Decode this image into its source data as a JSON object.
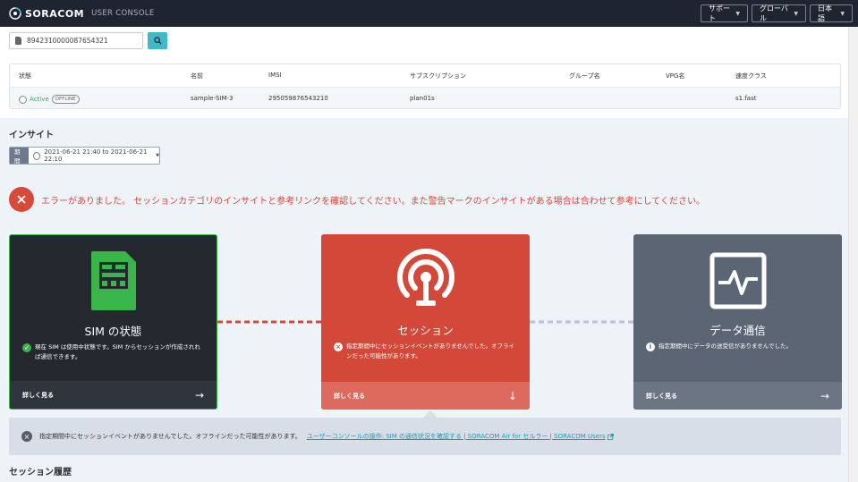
{
  "header": {
    "brand": "SORACOM",
    "subtitle": "USER CONSOLE",
    "buttons": [
      {
        "label": "サポート"
      },
      {
        "label": "グローバル"
      },
      {
        "label": "日本語"
      }
    ]
  },
  "search": {
    "value": "8942310000087654321",
    "icon": "search-icon"
  },
  "sim_table": {
    "columns": [
      "状態",
      "名前",
      "IMSI",
      "サブスクリプション",
      "グループ名",
      "VPG名",
      "速度クラス"
    ],
    "row": {
      "status": "Active",
      "online_badge": "OFFLINE",
      "name": "sample-SIM-3",
      "imsi": "295059876543210",
      "subscription": "plan01s",
      "group": "",
      "vpg": "",
      "speed_class": "s1.fast"
    }
  },
  "insight": {
    "title": "インサイト",
    "period_label": "期間",
    "period_value": "2021-06-21 21:40 to 2021-06-21 22:10",
    "error_message": "エラーがありました。 セッションカテゴリのインサイトと参考リンクを確認してください。また警告マークのインサイトがある場合は合わせて参考にしてください。",
    "colors": {
      "error": "#d64a3a",
      "ok": "#39b54a",
      "accent": "#3fb8c9"
    }
  },
  "cards": [
    {
      "title": "SIM の状態",
      "icon": "sim-card-icon",
      "status_icon": "check-circle-icon",
      "description": "現在 SIM は使用中状態です。SIM からセッションが作成されれば通信できます。",
      "footer_label": "詳しく見る",
      "footer_arrow": "→"
    },
    {
      "title": "セッション",
      "icon": "antenna-icon",
      "status_icon": "x-circle-icon",
      "description": "指定期間中にセッションイベントがありませんでした。オフラインだった可能性があります。",
      "footer_label": "詳しく見る",
      "footer_arrow": "↓"
    },
    {
      "title": "データ通信",
      "icon": "activity-chart-icon",
      "status_icon": "info-circle-icon",
      "description": "指定期間中にデータの送受信がありませんでした。",
      "footer_label": "詳しく見る",
      "footer_arrow": "→"
    }
  ],
  "session_info": {
    "message": "指定期間中にセッションイベントがありませんでした。オフラインだった可能性があります。",
    "link": "ユーザーコンソールの操作: SIM の通信状況を確認する | SORACOM Air for セルラー | SORACOM Users"
  },
  "session_history": {
    "title": "セッション履歴"
  }
}
